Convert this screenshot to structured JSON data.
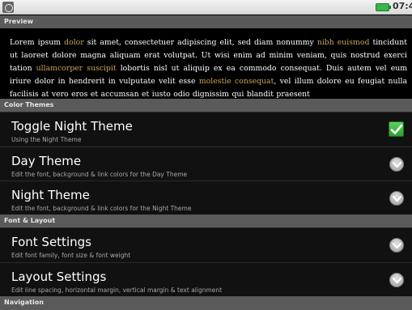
{
  "status_bar": {
    "time": "07:4",
    "left_icon": "usb-debug-icon",
    "battery_icon": "battery-icon"
  },
  "sections": {
    "preview": "Preview",
    "color_themes": "Color Themes",
    "font_layout": "Font & Layout",
    "navigation": "Navigation"
  },
  "preview": {
    "seg1": "Lorem ipsum ",
    "link1": "dolor",
    "seg2": " sit amet, consectetuer adipiscing elit, sed diam nonummy ",
    "link2": "nibh euismod",
    "seg3": " tincidunt ut laoreet dolore magna aliquam erat volutpat. Ut wisi enim ad minim veniam, quis nostrud exerci tation ",
    "link3": "ullamcorper suscipit",
    "seg4": " lobortis nisl ut aliquip ex ea commodo consequat. Duis autem vel eum iriure dolor in hendrerit in vulputate velit esse ",
    "link4": "molestie consequat",
    "seg5": ", vel illum dolore eu feugiat nulla facilisis at vero eros et accumsan et iusto odio dignissim qui blandit praesent",
    "text_color": "#ffffff",
    "link_color": "#c9a458"
  },
  "prefs": {
    "night_toggle": {
      "title": "Toggle Night Theme",
      "summary": "Using the Night Theme",
      "checked": true
    },
    "day_theme": {
      "title": "Day Theme",
      "summary": "Edit the font, background & link colors for the Day Theme"
    },
    "night_theme": {
      "title": "Night Theme",
      "summary": "Edit the font, background & link colors for the Night Theme"
    },
    "font_settings": {
      "title": "Font Settings",
      "summary": "Edit font family, font size & font weight"
    },
    "layout_settings": {
      "title": "Layout Settings",
      "summary": "Edit line spacing, horizontal margin, vertical margin & text alignment"
    }
  },
  "colors": {
    "section_header_bg": "#5a5a5a",
    "checkbox_green": "#3fb83f"
  }
}
